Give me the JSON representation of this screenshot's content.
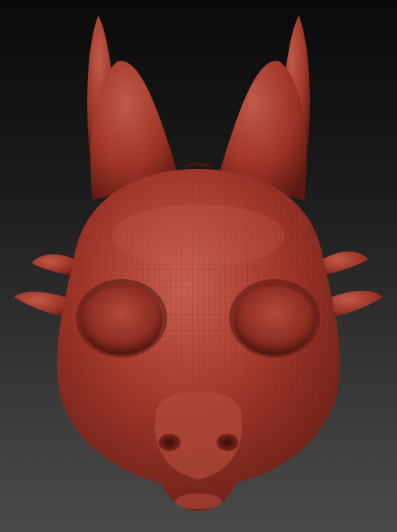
{
  "scene": {
    "subject": "sculpted-dragon-mask",
    "icon": "dragon-mask-icon",
    "colors": {
      "background_top": "#0a0a0a",
      "background_bottom": "#4a4a4a",
      "clay_base": "#a5382c",
      "clay_highlight": "#c8604f",
      "clay_shadow": "#5e1a12",
      "wireframe": "#7a2a20"
    }
  }
}
